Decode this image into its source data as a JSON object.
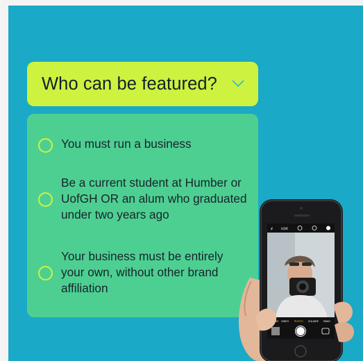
{
  "header": {
    "title": "Who can be featured?",
    "accent": "#cdf23f",
    "background": "#1aa9c6"
  },
  "criteria": [
    {
      "text": "You must run a business",
      "icon": "radio-ring-icon"
    },
    {
      "text": "Be a current student at Humber or UofGH OR an alum who graduated under two years ago",
      "icon": "radio-ring-icon"
    },
    {
      "text": "Your business must be entirely your own, without other brand affiliation",
      "icon": "radio-ring-icon"
    }
  ],
  "phone": {
    "camera_modes": [
      "SLO-MO",
      "VIDEO",
      "PHOTO",
      "SQUARE",
      "PANO"
    ],
    "status_labels": [
      "HDR"
    ]
  }
}
